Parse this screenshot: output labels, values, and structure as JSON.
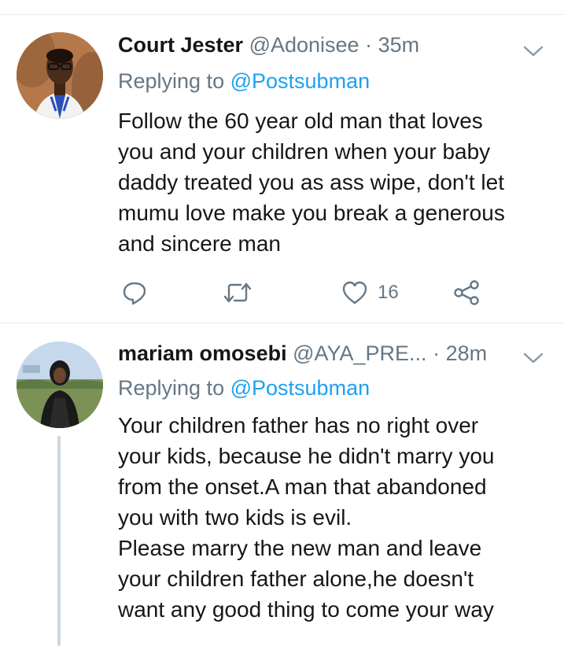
{
  "tweets": [
    {
      "display_name": "Court Jester",
      "handle": "@Adonisee",
      "separator": "·",
      "time": "35m",
      "replying_prefix": "Replying to",
      "replying_to": "@Postsubman",
      "lines": [
        "Follow the 60 year old man that loves",
        "you and your children when your baby",
        "daddy treated you as ass wipe, don't let",
        "mumu love make you break a generous",
        "and sincere man"
      ],
      "likes": "16",
      "icons": [
        "reply-icon",
        "retweet-icon",
        "like-icon",
        "share-icon",
        "chevron-down-icon"
      ]
    },
    {
      "display_name": "mariam omosebi",
      "handle": "@AYA_PRE...",
      "separator": "·",
      "time": "28m",
      "replying_prefix": "Replying to",
      "replying_to": "@Postsubman",
      "lines": [
        "Your children father has no right over",
        "your kids, because he didn't marry you",
        "from the onset.A man that abandoned",
        "you with two kids is evil.",
        "Please marry the new man and leave",
        "your children father alone,he doesn't",
        "want any good thing to come your way"
      ]
    }
  ],
  "colors": {
    "text": "#14171a",
    "secondary": "#657786",
    "link": "#1da1f2",
    "divider": "#e6ecf0",
    "thread_line": "#ccd6dd"
  }
}
